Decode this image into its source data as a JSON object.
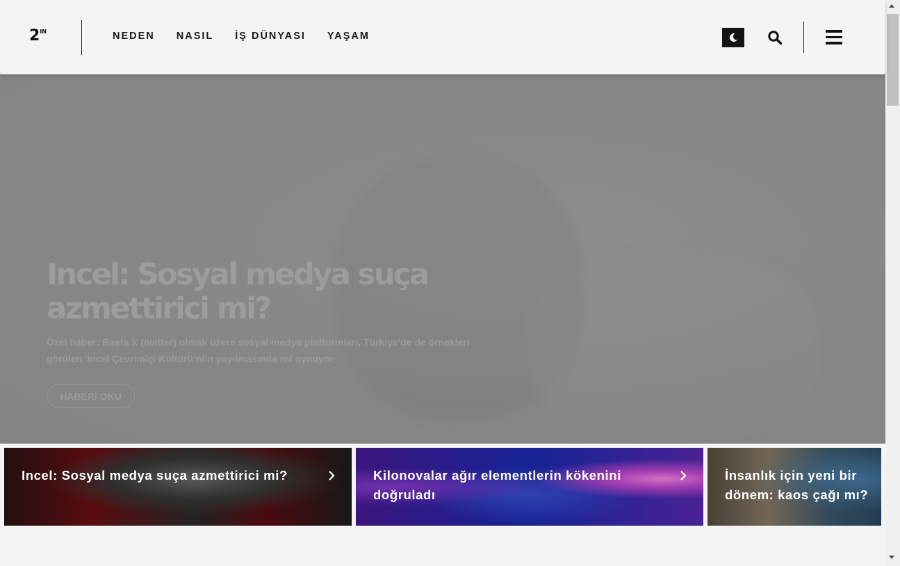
{
  "header": {
    "logo_main": "2",
    "logo_sup": "IN",
    "nav": [
      "NEDEN",
      "NASIL",
      "İŞ DÜNYASI",
      "YAŞAM"
    ],
    "icons": {
      "theme": "moon-icon",
      "search": "search-icon",
      "menu": "hamburger-menu-icon"
    }
  },
  "hero": {
    "title": "Incel: Sosyal medya suça azmettirici mi?",
    "description": "Özel haber: Başta X (twitter) olmak üzere sosyal medya platformları, Türkiye'de de örnekleri görülen 'Incel Çevrimiçi Kültürü'nün yayılmasında rol oynuyor.",
    "button_label": "HABERİ OKU"
  },
  "cards": [
    {
      "title": "Incel: Sosyal medya suça azmettirici mi?",
      "icon": "chevron-right-icon"
    },
    {
      "title": "Kilonovalar ağır elementlerin kökenini doğruladı",
      "icon": "chevron-right-icon"
    },
    {
      "title": "İnsanlık için yeni bir dönem: kaos çağı mı?",
      "icon": "chevron-right-icon"
    }
  ],
  "colors": {
    "accent_dark": "#141414",
    "hero_overlay": "#878787",
    "card_text": "#ffffff"
  }
}
